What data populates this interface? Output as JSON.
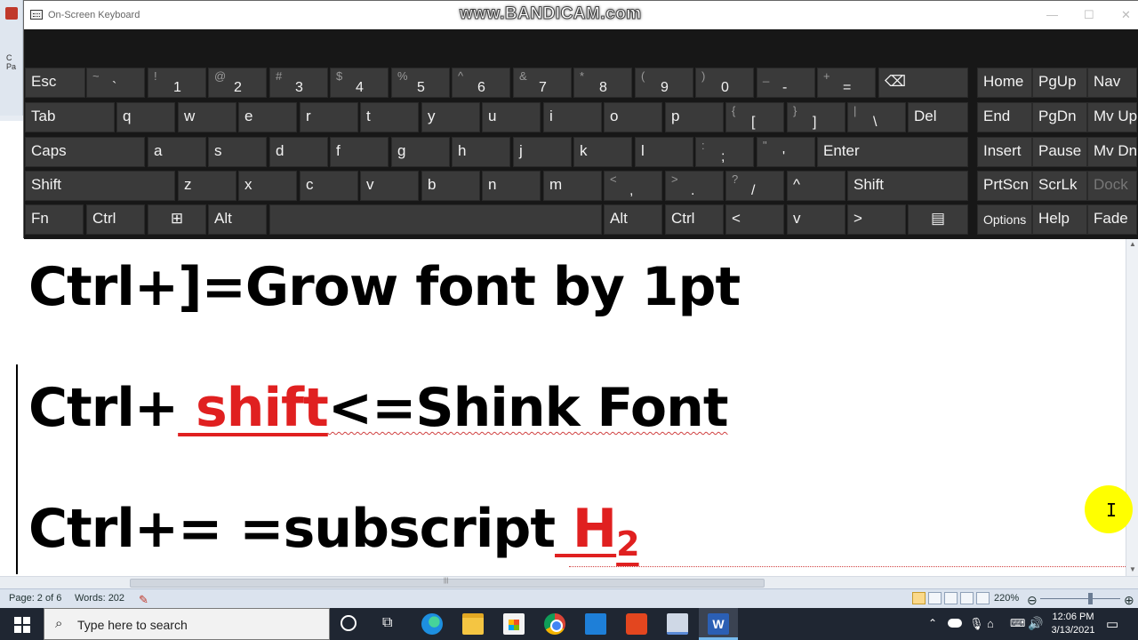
{
  "osk": {
    "title": "On-Screen Keyboard",
    "watermark": "www.BANDICAM.com",
    "controls": {
      "minimize": "—",
      "maximize": "☐",
      "close": "✕"
    },
    "keys": {
      "esc": "Esc",
      "r1_grave": {
        "shift": "~",
        "main": "`"
      },
      "r1_1": {
        "shift": "!",
        "main": "1"
      },
      "r1_2": {
        "shift": "@",
        "main": "2"
      },
      "r1_3": {
        "shift": "#",
        "main": "3"
      },
      "r1_4": {
        "shift": "$",
        "main": "4"
      },
      "r1_5": {
        "shift": "%",
        "main": "5"
      },
      "r1_6": {
        "shift": "^",
        "main": "6"
      },
      "r1_7": {
        "shift": "&",
        "main": "7"
      },
      "r1_8": {
        "shift": "*",
        "main": "8"
      },
      "r1_9": {
        "shift": "(",
        "main": "9"
      },
      "r1_0": {
        "shift": ")",
        "main": "0"
      },
      "r1_minus": {
        "shift": "_",
        "main": "-"
      },
      "r1_equals": {
        "shift": "+",
        "main": "="
      },
      "backspace": "⌫",
      "home": "Home",
      "pgup": "PgUp",
      "nav": "Nav",
      "tab": "Tab",
      "q": "q",
      "w": "w",
      "e": "e",
      "r": "r",
      "t": "t",
      "y": "y",
      "u": "u",
      "i": "i",
      "o": "o",
      "p": "p",
      "lbracket": {
        "shift": "{",
        "main": "["
      },
      "rbracket": {
        "shift": "}",
        "main": "]"
      },
      "backslash": {
        "shift": "|",
        "main": "\\"
      },
      "del": "Del",
      "end": "End",
      "pgdn": "PgDn",
      "mvup": "Mv Up",
      "caps": "Caps",
      "a": "a",
      "s": "s",
      "d": "d",
      "f": "f",
      "g": "g",
      "h": "h",
      "j": "j",
      "k": "k",
      "l": "l",
      "semicolon": {
        "shift": ":",
        "main": ";"
      },
      "quote": {
        "shift": "\"",
        "main": "'"
      },
      "enter": "Enter",
      "insert": "Insert",
      "pause": "Pause",
      "mvdn": "Mv Dn",
      "lshift": "Shift",
      "z": "z",
      "x": "x",
      "c": "c",
      "v": "v",
      "b": "b",
      "n": "n",
      "m": "m",
      "comma": {
        "shift": "<",
        "main": ","
      },
      "period": {
        "shift": ">",
        "main": "."
      },
      "slash": {
        "shift": "?",
        "main": "/"
      },
      "up": "^",
      "rshift": "Shift",
      "prtscn": "PrtScn",
      "scrlk": "ScrLk",
      "dock": "Dock",
      "fn": "Fn",
      "lctrl": "Ctrl",
      "win": "⊞",
      "lalt": "Alt",
      "space": "",
      "ralt": "Alt",
      "rctrl": "Ctrl",
      "left": "<",
      "down": "v",
      "right": ">",
      "menu": "▤",
      "options": "Options",
      "help": "Help",
      "fade": "Fade"
    }
  },
  "document": {
    "line1": {
      "text": "Ctrl+]=Grow font by 1pt"
    },
    "line2": {
      "prefix": "Ctrl+",
      "highlight": " shift",
      "suffix": "<=Shink Font"
    },
    "line3": {
      "prefix": "Ctrl+= =subscript",
      "highlight_base": " H",
      "highlight_sub": "2"
    }
  },
  "statusbar": {
    "page": "Page: 2 of 6",
    "words": "Words: 202",
    "zoom": "220%",
    "zoom_minus": "⊖",
    "zoom_plus": "⊕"
  },
  "taskbar": {
    "search_placeholder": "Type here to search",
    "word_letter": "W",
    "time": "12:06 PM",
    "date": "3/13/2021"
  },
  "colors": {
    "accent_red": "#e02020",
    "key_bg": "#3a3a3a",
    "taskbar_bg": "#1f2632",
    "cursor_highlight": "#ffff00"
  },
  "icons": {
    "search": "magnifier-icon",
    "start": "windows-icon",
    "cursor": "ibeam-cursor-icon"
  }
}
